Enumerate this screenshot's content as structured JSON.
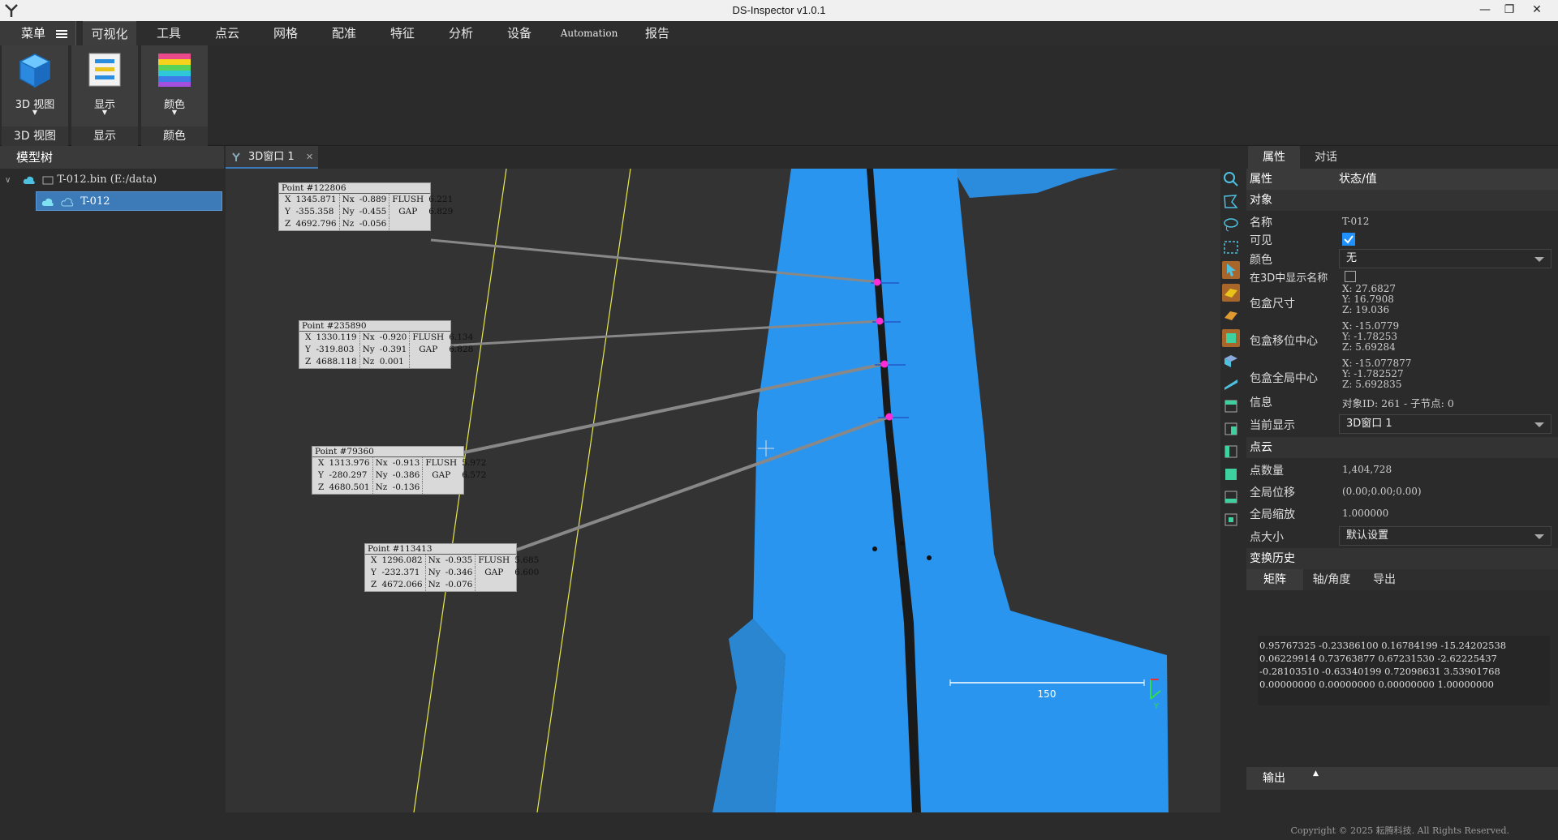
{
  "window": {
    "title": "DS-Inspector v1.0.1"
  },
  "menu": {
    "main_label": "菜单",
    "tabs": [
      {
        "label": "可视化",
        "active": true
      },
      {
        "label": "工具"
      },
      {
        "label": "点云"
      },
      {
        "label": "网格"
      },
      {
        "label": "配准"
      },
      {
        "label": "特征"
      },
      {
        "label": "分析"
      },
      {
        "label": "设备"
      },
      {
        "label": "Automation"
      },
      {
        "label": "报告"
      }
    ]
  },
  "ribbon": {
    "groups": [
      {
        "button": "3D 视图",
        "label": "3D 视图",
        "icon": "cube-icon"
      },
      {
        "button": "显示",
        "label": "显示",
        "icon": "display-icon"
      },
      {
        "button": "颜色",
        "label": "颜色",
        "icon": "color-palette-icon"
      }
    ]
  },
  "model_tree": {
    "title": "模型树",
    "file": "T-012.bin (E:/data)",
    "child": "T-012"
  },
  "viewport": {
    "tab_label": "3D窗口 1",
    "scale_label": "150",
    "axis_label": "Y",
    "point_labels": [
      {
        "title": "Point #122806",
        "x": "1345.871",
        "y": "-355.358",
        "z": "4692.796",
        "nx": "-0.889",
        "ny": "-0.455",
        "nz": "-0.056",
        "flush": "6.221",
        "gap": "6.829"
      },
      {
        "title": "Point #235890",
        "x": "1330.119",
        "y": "-319.803",
        "z": "4688.118",
        "nx": "-0.920",
        "ny": "-0.391",
        "nz": "0.001",
        "flush": "6.134",
        "gap": "6.828"
      },
      {
        "title": "Point #79360",
        "x": "1313.976",
        "y": "-280.297",
        "z": "4680.501",
        "nx": "-0.913",
        "ny": "-0.386",
        "nz": "-0.136",
        "flush": "5.972",
        "gap": "6.572"
      },
      {
        "title": "Point #113413",
        "x": "1296.082",
        "y": "-232.371",
        "z": "4672.066",
        "nx": "-0.935",
        "ny": "-0.346",
        "nz": "-0.076",
        "flush": "5.685",
        "gap": "6.600"
      }
    ],
    "field_labels": {
      "x": "X",
      "y": "Y",
      "z": "Z",
      "nx": "Nx",
      "ny": "Ny",
      "nz": "Nz",
      "flush": "FLUSH",
      "gap": "GAP"
    }
  },
  "properties": {
    "tabs": [
      "属性",
      "对话"
    ],
    "col_property": "属性",
    "col_value": "状态/值",
    "section_object": "对象",
    "name_label": "名称",
    "name_value": "T-012",
    "visible_label": "可见",
    "color_label": "颜色",
    "color_value": "无",
    "show_name_label": "在3D中显示名称",
    "bbox_size_label": "包盒尺寸",
    "bbox_size": [
      "X: 27.6827",
      "Y: 16.7908",
      "Z: 19.036"
    ],
    "bbox_shift_label": "包盒移位中心",
    "bbox_shift": [
      "X: -15.0779",
      "Y: -1.78253",
      "Z: 5.69284"
    ],
    "bbox_global_label": "包盒全局中心",
    "bbox_global": [
      "X: -15.077877",
      "Y: -1.782527",
      "Z: 5.692835"
    ],
    "info_label": "信息",
    "info_value": "对象ID: 261 - 子节点: 0",
    "current_display_label": "当前显示",
    "current_display_value": "3D窗口 1",
    "section_cloud": "点云",
    "points_label": "点数量",
    "points_value": "1,404,728",
    "global_shift_label": "全局位移",
    "global_shift_value": "(0.00;0.00;0.00)",
    "global_scale_label": "全局缩放",
    "global_scale_value": "1.000000",
    "point_size_label": "点大小",
    "point_size_value": "默认设置",
    "section_transform": "变换历史",
    "matrix_tabs": [
      "矩阵",
      "轴/角度",
      "导出"
    ],
    "matrix": "0.95767325 -0.23386100 0.16784199 -15.24202538\n0.06229914 0.73763877 0.67231530 -2.62225437\n-0.28103510 -0.63340199 0.72098631 3.53901768\n0.00000000 0.00000000 0.00000000 1.00000000",
    "output_label": "输出"
  },
  "footer": {
    "copyright": "Copyright © 2025 耘腾科技. All Rights Reserved."
  },
  "colors": {
    "accent": "#3c7ab8",
    "cloud": "#2a95ee",
    "guide_line": "#e8e84a",
    "marker": "#ff2bd6"
  }
}
